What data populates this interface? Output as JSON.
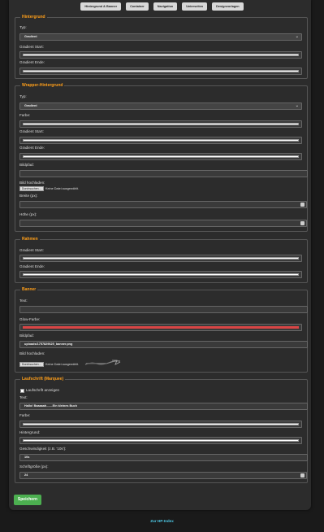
{
  "tabs": [
    "Hintergrund & Banner",
    "Container",
    "Navigation",
    "Unterseiten",
    "Designvorlagen"
  ],
  "hintergrund": {
    "legend": "Hintergrund",
    "typ_label": "Typ:",
    "typ_value": "Gradient",
    "gradient_start_label": "Gradient Start:",
    "gradient_ende_label": "Gradient Ende:",
    "start_color": "#ffffff",
    "end_color": "#ffffff"
  },
  "wrapper": {
    "legend": "Wrapper-Hintergrund",
    "typ_label": "Typ:",
    "typ_value": "Gradient",
    "farbe_label": "Farbe:",
    "gradient_start_label": "Gradient Start:",
    "gradient_ende_label": "Gradient Ende:",
    "bildpfad_label": "Bildpfad:",
    "bildpfad_value": "",
    "upload_label": "Bild hochladen:",
    "file_button": "Durchsuchen...",
    "file_text": "Keine Datei ausgewählt.",
    "breite_label": "Breite (px):",
    "hoehe_label": "Höhe (px):",
    "farbe_color": "#ffffff",
    "start_color": "#ffffff",
    "end_color": "#ffffff"
  },
  "rahmen": {
    "legend": "Rahmen",
    "gradient_start_label": "Gradient Start:",
    "gradient_ende_label": "Gradient Ende:",
    "start_color": "#ffffff",
    "end_color": "#ffffff"
  },
  "banner": {
    "legend": "Banner",
    "text_label": "Text:",
    "text_value": "",
    "glow_label": "Glow-Farbe:",
    "glow_color": "#d94545",
    "bildpfad_label": "Bildpfad:",
    "bildpfad_value": "uploads/1757829625_banner.png",
    "upload_label": "Bild hochladen:",
    "file_button": "Durchsuchen...",
    "file_text": "Keine Datei ausgewählt."
  },
  "laufschrift": {
    "legend": "Laufschrift (Marquee)",
    "checkbox_label": "Laufschrift anzeigen",
    "text_label": "Text:",
    "text_value": "Hallo! Baaaaah.......Ein kleines Buch",
    "farbe_label": "Farbe:",
    "farbe_color": "#ffffff",
    "hintergrund_label": "Hintergrund:",
    "hintergrund_color": "#ffffff",
    "speed_label": "Geschwindigkeit (z.B. '10s'):",
    "speed_value": "10s",
    "fontsize_label": "Schriftgröße (px):",
    "fontsize_value": "24"
  },
  "save_label": "Speichern",
  "footer_link": "Zur HP-Index"
}
